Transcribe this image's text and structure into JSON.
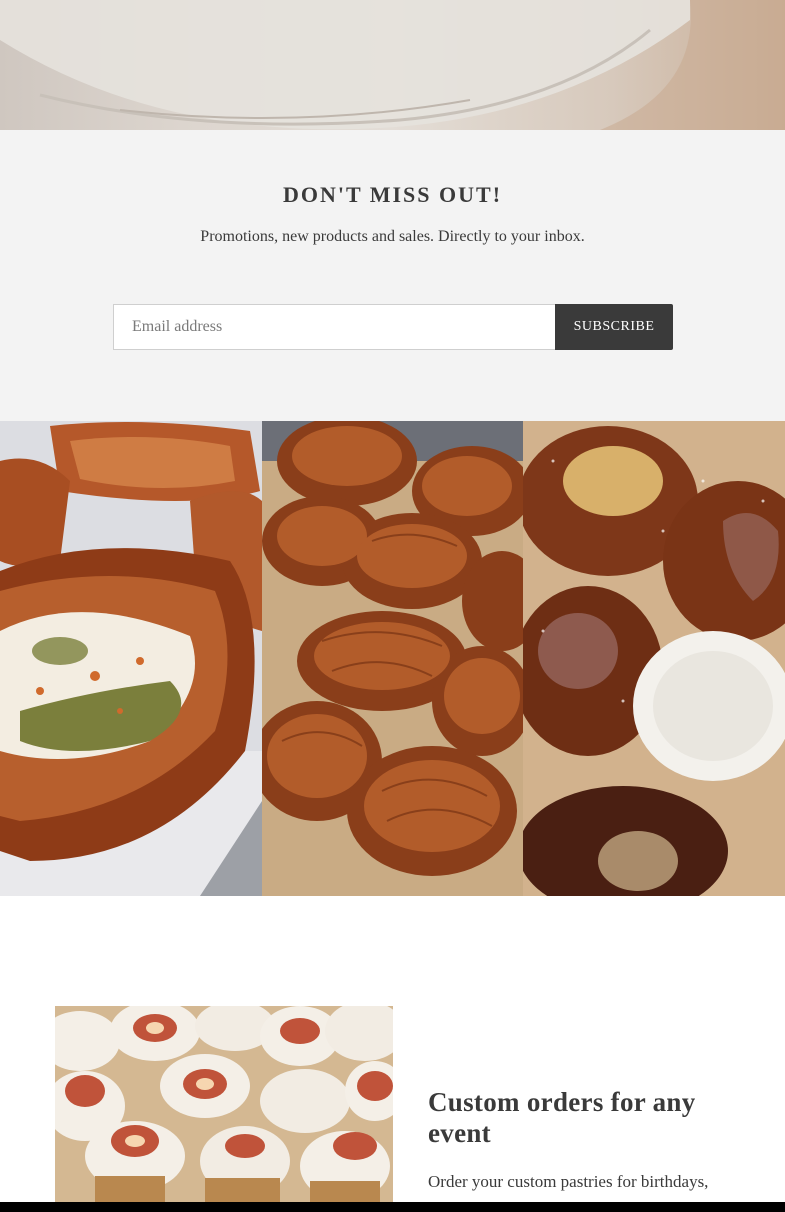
{
  "newsletter": {
    "title": "DON'T MISS OUT!",
    "subtitle": "Promotions, new products and sales. Directly to your inbox.",
    "email_placeholder": "Email address",
    "subscribe_label": "SUBSCRIBE"
  },
  "gallery": {
    "images": [
      {
        "name": "pesto-danish-image"
      },
      {
        "name": "croissants-image"
      },
      {
        "name": "filled-pastries-image"
      }
    ]
  },
  "custom_orders": {
    "title": "Custom orders for any event",
    "body": "Order your custom pastries for birthdays, showers, holidays, parties"
  },
  "colors": {
    "newsletter_bg": "#f3f3f3",
    "button_bg": "#3a3a3a",
    "text": "#3a3a3a"
  }
}
